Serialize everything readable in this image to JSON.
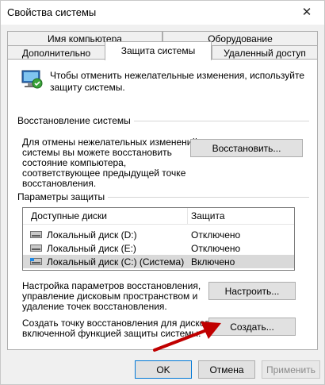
{
  "window": {
    "title": "Свойства системы",
    "close_glyph": "✕"
  },
  "tabs": {
    "top_row": [
      "Имя компьютера",
      "Оборудование"
    ],
    "bottom_row": [
      "Дополнительно",
      "Защита системы",
      "Удаленный доступ"
    ],
    "active": "Защита системы"
  },
  "intro": {
    "icon": "system-protection-icon",
    "text_line1": "Чтобы отменить нежелательные изменения, используйте",
    "text_line2": "защиту системы."
  },
  "restore_section": {
    "title": "Восстановление системы",
    "text_lines": [
      "Для отмены нежелательных изменений",
      "системы вы можете восстановить",
      "состояние компьютера,",
      "соответствующее предыдущей точке",
      "восстановления."
    ],
    "button_label": "Восстановить..."
  },
  "protection_section": {
    "title": "Параметры защиты",
    "columns": [
      "Доступные диски",
      "Защита"
    ],
    "rows": [
      {
        "drive": "Локальный диск (D:)",
        "status": "Отключено",
        "icon": "hard-drive-icon",
        "selected": false
      },
      {
        "drive": "Локальный диск (E:)",
        "status": "Отключено",
        "icon": "hard-drive-icon",
        "selected": false
      },
      {
        "drive": "Локальный диск (C:) (Система)",
        "status": "Включено",
        "icon": "system-drive-icon",
        "selected": true
      }
    ],
    "configure_text_lines": [
      "Настройка параметров восстановления,",
      "управление дисковым пространством и",
      "удаление точек восстановления."
    ],
    "configure_button": "Настроить...",
    "create_text_lines": [
      "Создать точку восстановления для дисков с",
      "включенной функцией защиты системы."
    ],
    "create_button": "Создать..."
  },
  "footer": {
    "ok": "OK",
    "cancel": "Отмена",
    "apply": "Применить"
  },
  "colors": {
    "annotation_arrow": "#c00000",
    "default_button_border": "#0078d7"
  }
}
